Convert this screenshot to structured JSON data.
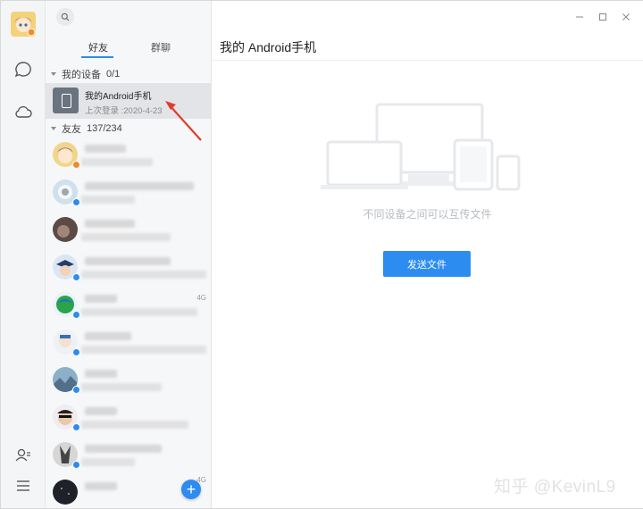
{
  "sidebar": {
    "icons": [
      "avatar",
      "chat-bubble-icon",
      "cloud-icon",
      "contacts-icon",
      "menu-icon"
    ]
  },
  "list": {
    "tabs": [
      {
        "label": "好友",
        "active": true
      },
      {
        "label": "群聊",
        "active": false
      }
    ],
    "groups": {
      "devices": {
        "name": "我的设备",
        "count": "0/1"
      },
      "friends": {
        "name": "友友",
        "count": "137/234"
      }
    },
    "device": {
      "name": "我的Android手机",
      "last_login": "上次登录 :2020-4-23"
    },
    "friends": [
      {
        "net": ""
      },
      {
        "net": ""
      },
      {
        "net": ""
      },
      {
        "net": ""
      },
      {
        "net": "4G"
      },
      {
        "net": ""
      },
      {
        "net": ""
      },
      {
        "net": ""
      },
      {
        "net": ""
      },
      {
        "net": "4G"
      }
    ],
    "add_label": "+"
  },
  "main": {
    "title": "我的 Android手机",
    "hint": "不同设备之间可以互传文件",
    "send_button": "发送文件"
  },
  "window": {
    "minimize": "—",
    "maximize": "☐",
    "close": "✕"
  },
  "watermark": "知乎 @KevinL9",
  "colors": {
    "accent": "#2d8cf0",
    "arrow": "#e03c2c"
  }
}
